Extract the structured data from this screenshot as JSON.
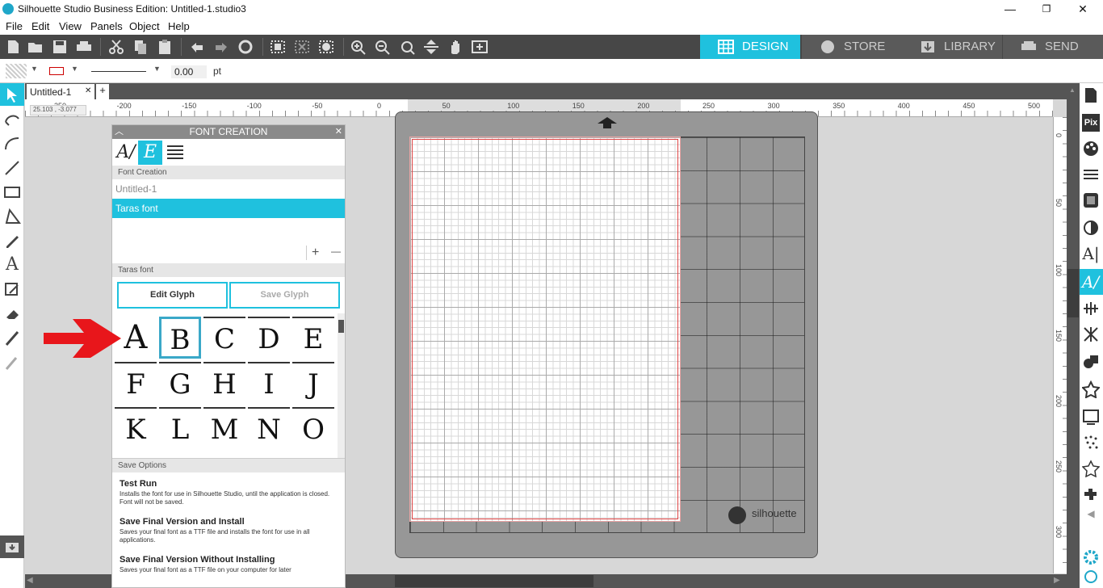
{
  "window": {
    "title": "Silhouette Studio Business Edition: Untitled-1.studio3",
    "minimize": "—",
    "restore": "❐",
    "close": "✕"
  },
  "menu": [
    "File",
    "Edit",
    "View",
    "Panels",
    "Object",
    "Help"
  ],
  "nav_tabs": [
    {
      "label": "DESIGN",
      "active": true
    },
    {
      "label": "STORE",
      "active": false
    },
    {
      "label": "LIBRARY",
      "active": false
    },
    {
      "label": "SEND",
      "active": false
    }
  ],
  "props": {
    "line_width": "0.00",
    "unit": "pt"
  },
  "doc_tab": {
    "label": "Untitled-1",
    "close": "✕",
    "add": "+"
  },
  "cursor_coords": "25.103 , -3.077",
  "ruler_h_labels": [
    "-250",
    "-200",
    "-150",
    "-100",
    "-50",
    "0",
    "50",
    "100",
    "150",
    "200",
    "250",
    "300",
    "350",
    "400",
    "450",
    "500"
  ],
  "ruler_v_labels": [
    "0",
    "50",
    "100",
    "150",
    "200",
    "250",
    "300"
  ],
  "font_panel": {
    "title": "FONT CREATION",
    "section_font_creation": "Font Creation",
    "fonts": [
      {
        "name": "Untitled-1",
        "selected": false
      },
      {
        "name": "Taras font",
        "selected": true
      }
    ],
    "add": "+",
    "remove": "—",
    "section_current_font": "Taras font",
    "edit_glyph": "Edit Glyph",
    "save_glyph": "Save Glyph",
    "glyphs": [
      "A",
      "B",
      "C",
      "D",
      "E",
      "F",
      "G",
      "H",
      "I",
      "J",
      "K",
      "L",
      "M",
      "N",
      "O"
    ],
    "selected_glyph": "B",
    "section_save": "Save Options",
    "save_options": [
      {
        "title": "Test Run",
        "desc": "Installs the font for use in Silhouette Studio, until the application is closed. Font will not be saved."
      },
      {
        "title": "Save Final Version and Install",
        "desc": "Saves your final font as a TTF file and installs the font for use in all applications."
      },
      {
        "title": "Save Final Version Without Installing",
        "desc": "Saves your final font as a TTF file on your computer for later"
      }
    ]
  },
  "mat": {
    "brand": "silhouette"
  },
  "colors": {
    "accent": "#1fc1de",
    "toolbar": "#474747",
    "arrow": "#e8161b"
  }
}
